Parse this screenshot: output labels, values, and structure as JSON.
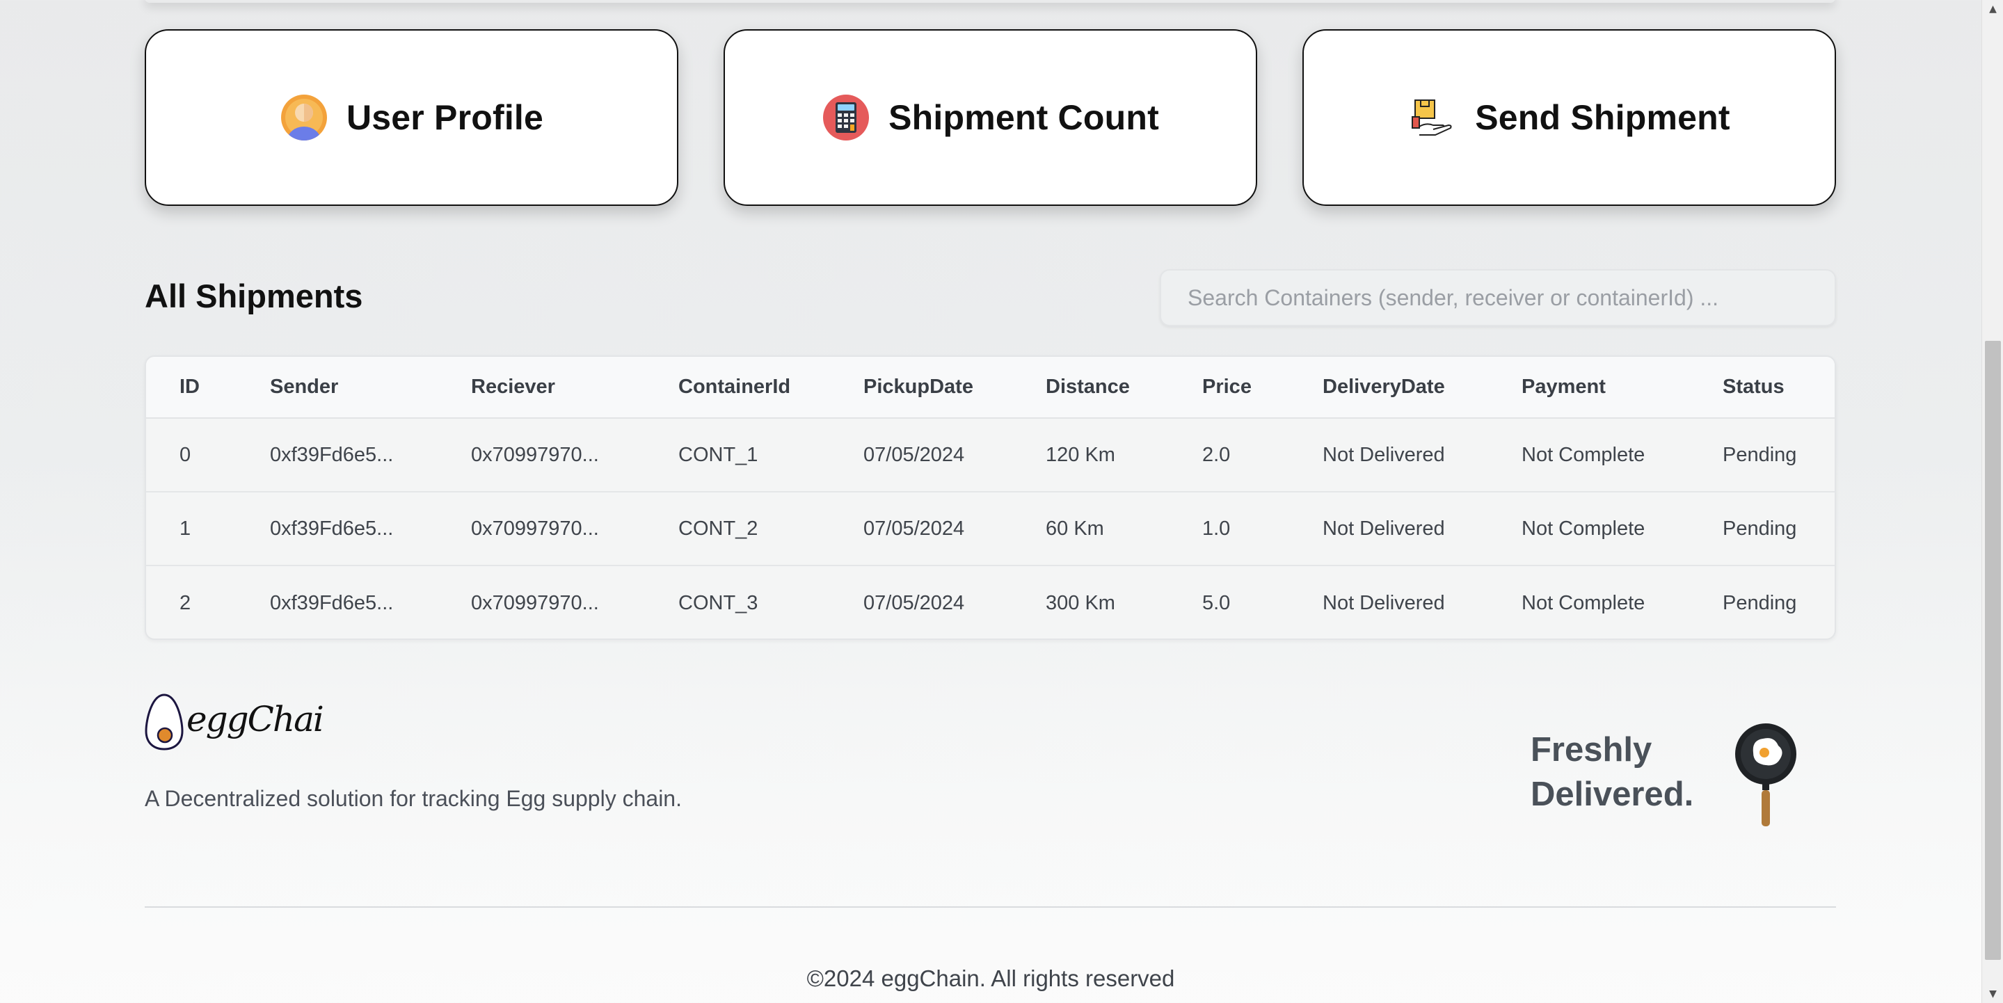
{
  "cards": {
    "user_profile": {
      "label": "User Profile",
      "icon": "user-avatar-icon"
    },
    "shipment_count": {
      "label": "Shipment Count",
      "icon": "calculator-icon"
    },
    "send_shipment": {
      "label": "Send Shipment",
      "icon": "package-hand-icon"
    }
  },
  "shipments": {
    "title": "All Shipments",
    "search_placeholder": "Search Containers (sender, receiver or containerId) ...",
    "columns": [
      "ID",
      "Sender",
      "Reciever",
      "ContainerId",
      "PickupDate",
      "Distance",
      "Price",
      "DeliveryDate",
      "Payment",
      "Status"
    ],
    "rows": [
      [
        "0",
        "0xf39Fd6e5...",
        "0x70997970...",
        "CONT_1",
        "07/05/2024",
        "120 Km",
        "2.0",
        "Not Delivered",
        "Not Complete",
        "Pending"
      ],
      [
        "1",
        "0xf39Fd6e5...",
        "0x70997970...",
        "CONT_2",
        "07/05/2024",
        "60 Km",
        "1.0",
        "Not Delivered",
        "Not Complete",
        "Pending"
      ],
      [
        "2",
        "0xf39Fd6e5...",
        "0x70997970...",
        "CONT_3",
        "07/05/2024",
        "300 Km",
        "5.0",
        "Not Delivered",
        "Not Complete",
        "Pending"
      ]
    ]
  },
  "footer": {
    "brand": "eggChain",
    "description": "A Decentralized solution for tracking Egg supply chain.",
    "tagline_line1": "Freshly",
    "tagline_line2": "Delivered.",
    "copyright": "©2024 eggChain. All rights reserved"
  },
  "colors": {
    "card_border": "#111111",
    "text_dark": "#111111",
    "text_muted": "#3f444b",
    "egg_yolk": "#e08a2c",
    "pan_handle": "#b07a3a"
  }
}
